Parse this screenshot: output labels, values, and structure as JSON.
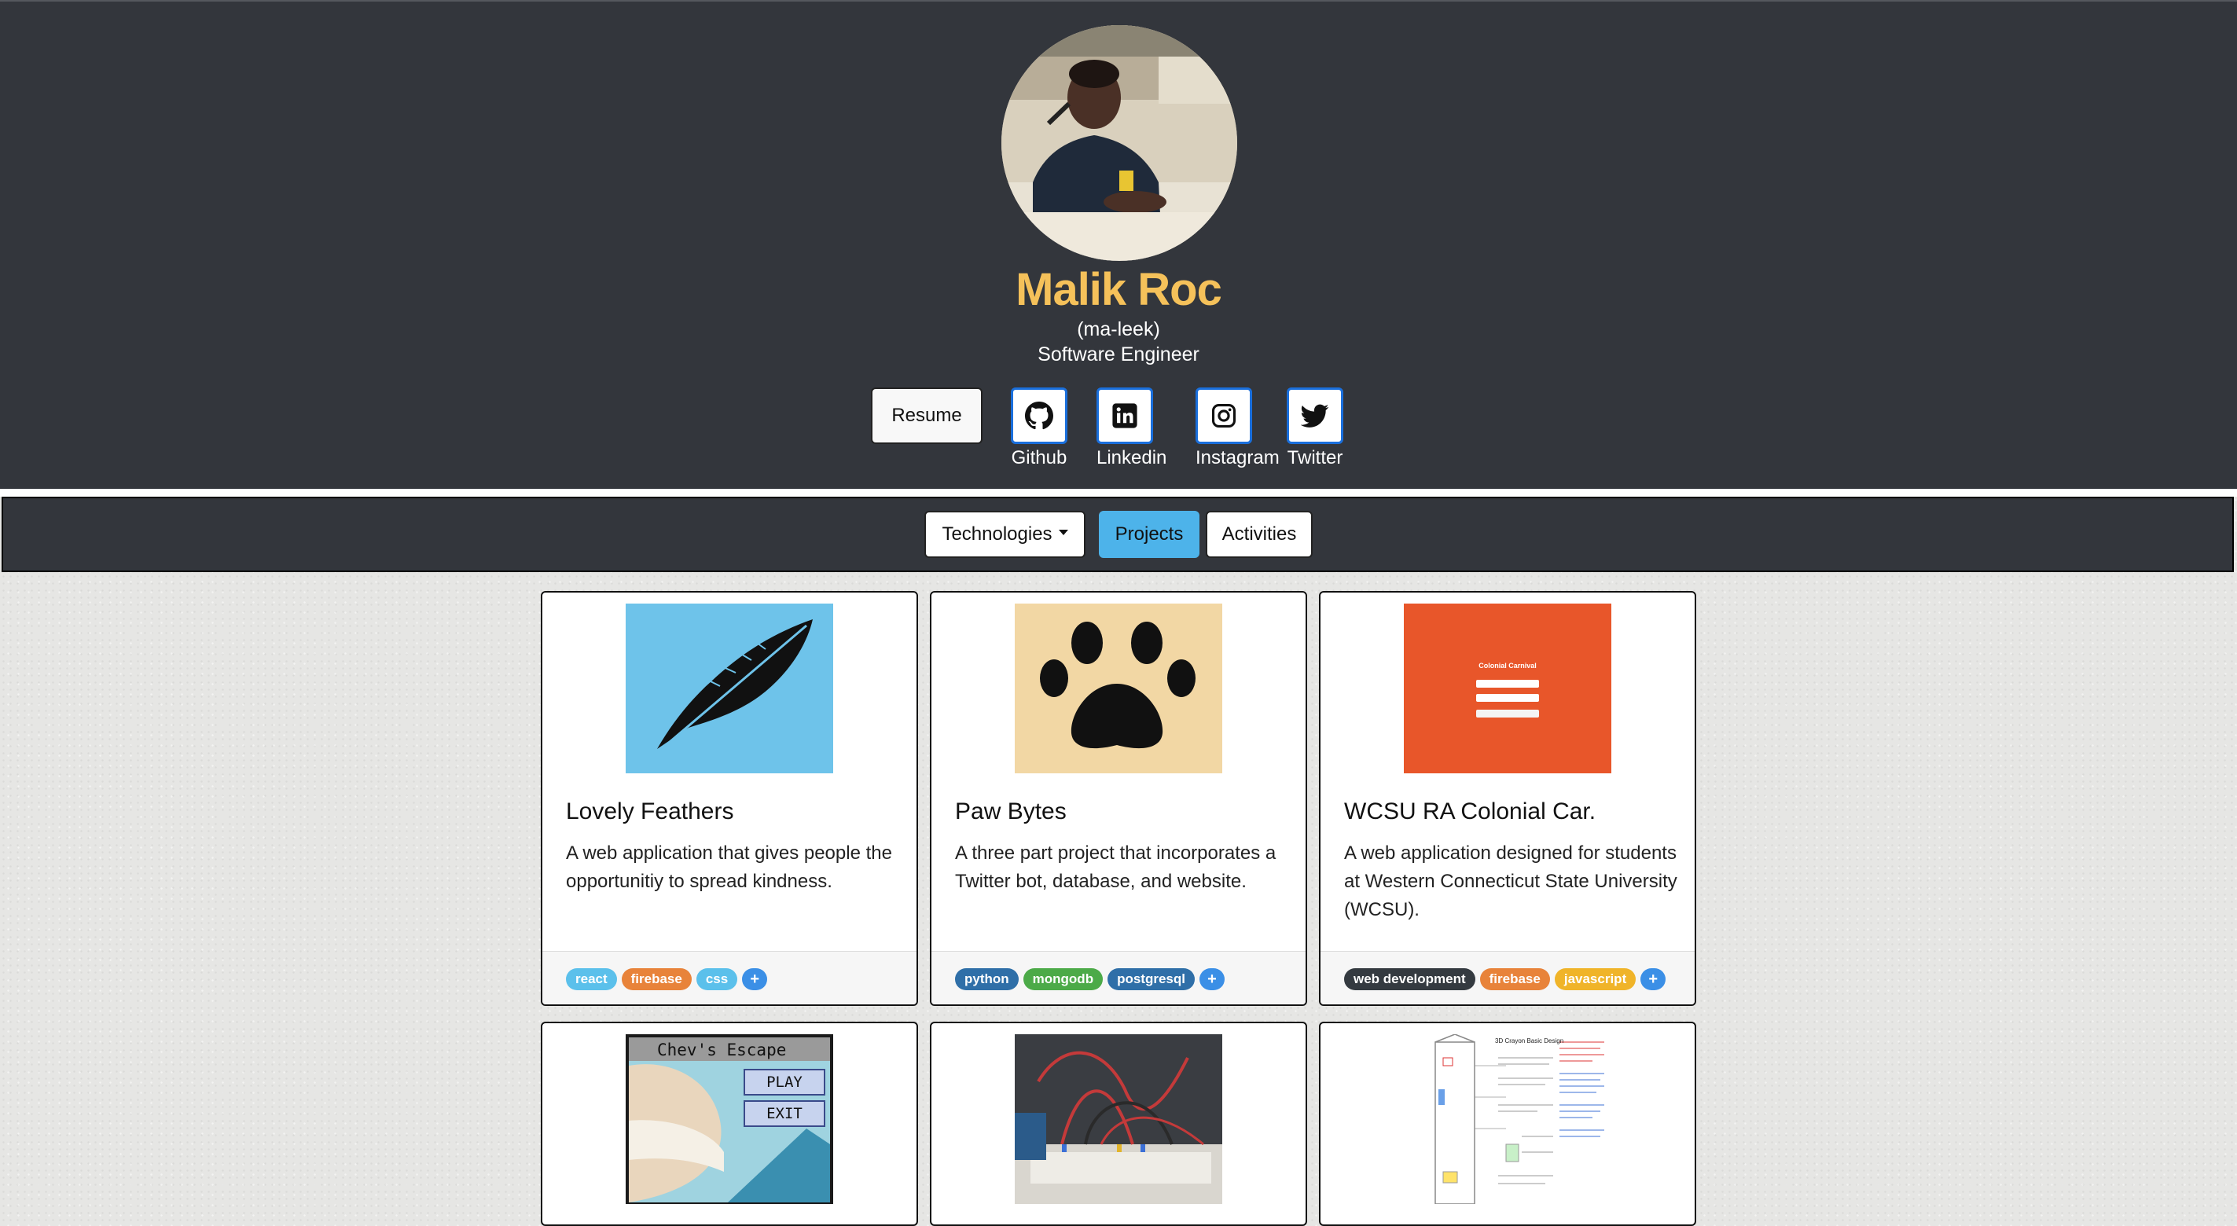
{
  "profile": {
    "name": "Malik Roc",
    "pronunciation": "(ma-leek)",
    "role": "Software Engineer",
    "resume_label": "Resume",
    "social": [
      {
        "label": "Github",
        "icon": "github-icon"
      },
      {
        "label": "Linkedin",
        "icon": "linkedin-icon"
      },
      {
        "label": "Instagram",
        "icon": "instagram-icon"
      },
      {
        "label": "Twitter",
        "icon": "twitter-icon"
      }
    ]
  },
  "nav": {
    "technologies_label": "Technologies",
    "projects_label": "Projects",
    "activities_label": "Activities",
    "active": "Projects"
  },
  "projects": [
    {
      "title": "Lovely Feathers",
      "description": "A web application that gives people the opportunitiy to spread kindness.",
      "tags": [
        "react",
        "firebase",
        "css"
      ],
      "more": "+",
      "thumb": "feather-image"
    },
    {
      "title": "Paw Bytes",
      "description": "A three part project that incorporates a Twitter bot, database, and website.",
      "tags": [
        "python",
        "mongodb",
        "postgresql"
      ],
      "more": "+",
      "thumb": "paw-image"
    },
    {
      "title": "WCSU RA Colonial Car.",
      "description": "A web application designed for students at Western Connecticut State University (WCSU).",
      "tags": [
        "web development",
        "firebase",
        "javascript"
      ],
      "more": "+",
      "thumb": "colonial-carnival-screenshot",
      "thumb_text": "Colonial Carnival"
    },
    {
      "title": "",
      "thumb": "chevs-escape-screenshot",
      "thumb_text": {
        "title": "Chev's Escape",
        "play": "PLAY",
        "exit": "EXIT"
      }
    },
    {
      "title": "",
      "thumb": "breadboard-photo"
    },
    {
      "title": "",
      "thumb": "design-document-image",
      "thumb_text": "3D Crayon Basic Design"
    }
  ],
  "colors": {
    "header_bg": "#33363c",
    "name_accent": "#f5c15a",
    "projects_active": "#4db3ea",
    "tag_react": "#5bc0eb",
    "tag_firebase": "#e8833a",
    "tag_css": "#5bc0eb",
    "tag_python": "#2f6fa8",
    "tag_mongodb": "#4caa48",
    "tag_postgresql": "#2f6fa8",
    "tag_webdev": "#343a40",
    "tag_javascript": "#f0b429",
    "tag_plus": "#3b8fe6"
  }
}
